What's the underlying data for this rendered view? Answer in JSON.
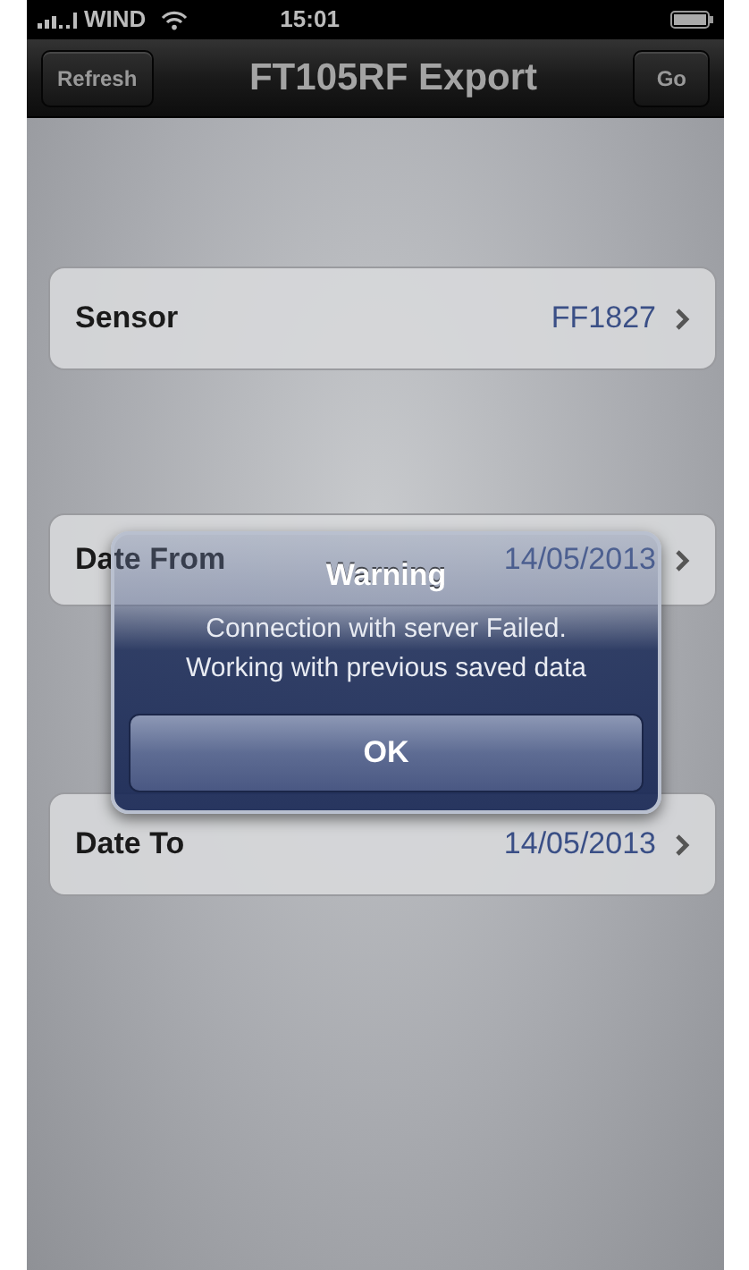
{
  "status_bar": {
    "carrier": "WIND",
    "time": "15:01"
  },
  "nav_bar": {
    "left_button": "Refresh",
    "title": "FT105RF Export",
    "right_button": "Go"
  },
  "rows": [
    {
      "label": "Sensor",
      "value": "FF1827"
    },
    {
      "label": "Date From",
      "value": "14/05/2013"
    },
    {
      "label": "Date To",
      "value": "14/05/2013"
    }
  ],
  "alert": {
    "title": "Warning",
    "message": "Connection with server Failed.\nWorking with previous saved data",
    "buttons": [
      "OK"
    ]
  }
}
